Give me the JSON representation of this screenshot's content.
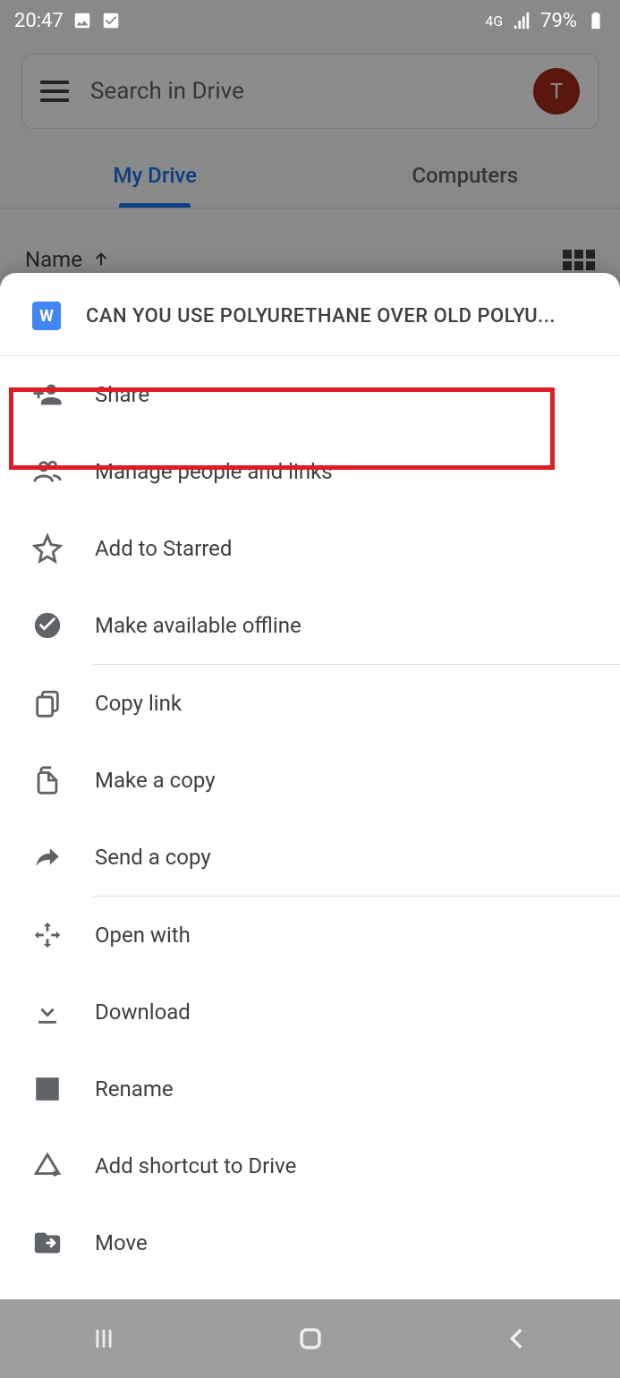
{
  "status": {
    "time": "20:47",
    "network": "4G",
    "battery": "79%"
  },
  "search": {
    "placeholder": "Search in Drive",
    "avatar_letter": "T"
  },
  "tabs": {
    "my_drive": "My Drive",
    "computers": "Computers"
  },
  "sort": {
    "label": "Name"
  },
  "sheet": {
    "file_title": "CAN YOU USE POLYURETHANE OVER OLD POLYU...",
    "file_icon_letter": "W",
    "items": {
      "share": "Share",
      "manage": "Manage people and links",
      "star": "Add to Starred",
      "offline": "Make available offline",
      "copylink": "Copy link",
      "makecopy": "Make a copy",
      "sendcopy": "Send a copy",
      "openwith": "Open with",
      "download": "Download",
      "rename": "Rename",
      "shortcut": "Add shortcut to Drive",
      "move": "Move"
    }
  }
}
